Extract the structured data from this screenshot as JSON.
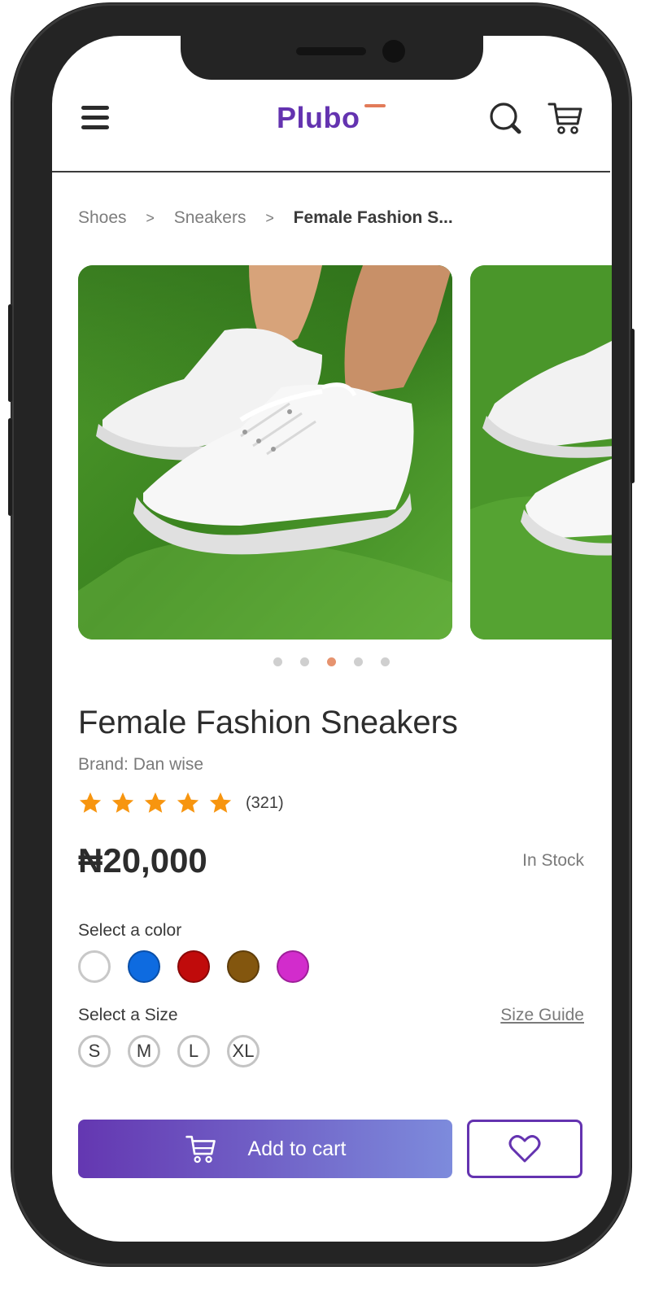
{
  "header": {
    "logo": "Plubo",
    "menu_icon": "hamburger-menu-icon",
    "search_icon": "search-icon",
    "cart_icon": "cart-icon",
    "brand_color": "#6433b0",
    "accent_color": "#e27b59"
  },
  "breadcrumb": {
    "items": [
      "Shoes",
      "Sneakers",
      "Female Fashion S..."
    ],
    "separator": ">"
  },
  "gallery": {
    "image_description": "white sneakers on green grass",
    "dot_count": 5,
    "active_index": 2
  },
  "product": {
    "title": "Female Fashion Sneakers",
    "brand": "Brand: Dan wise",
    "rating": 5,
    "review_count": "(321)",
    "price": "₦20,000",
    "stock_status": "In Stock"
  },
  "color_picker": {
    "label": "Select a color",
    "options": [
      "#ffffff",
      "#0e6be0",
      "#c00b0b",
      "#83560e",
      "#d22ccc"
    ]
  },
  "size_picker": {
    "label": "Select a Size",
    "guide_link": "Size Guide",
    "options": [
      "S",
      "M",
      "L",
      "XL"
    ]
  },
  "actions": {
    "add_to_cart": "Add to cart",
    "wishlist_icon": "heart-icon"
  }
}
